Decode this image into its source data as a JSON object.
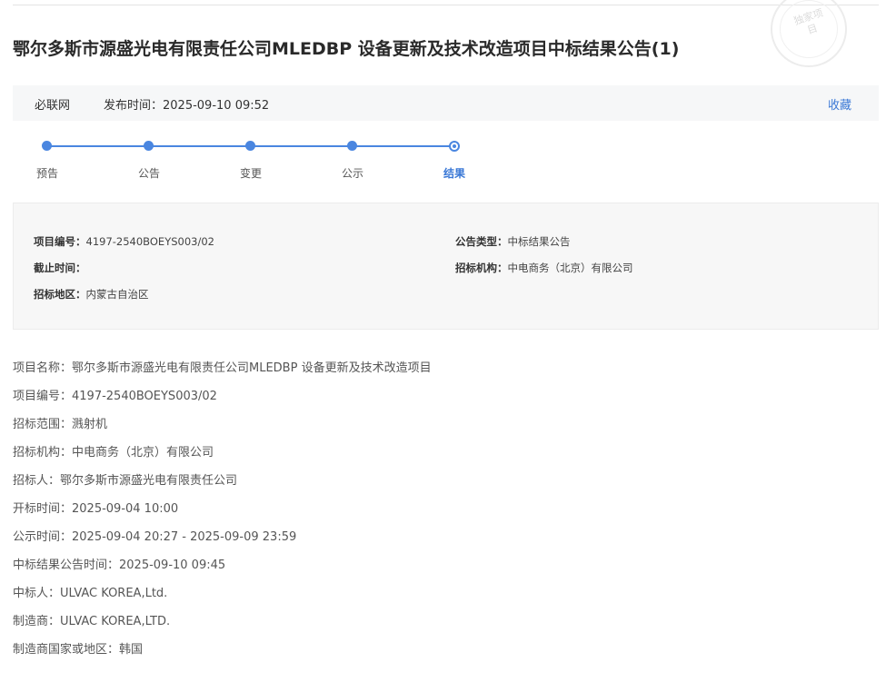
{
  "header": {
    "title": "鄂尔多斯市源盛光电有限责任公司MLEDBP 设备更新及技术改造项目中标结果公告(1)",
    "seal_text": "独家项目"
  },
  "meta": {
    "source": "必联网",
    "publish_label": "发布时间：",
    "publish_time": "2025-09-10 09:52",
    "favorite_label": "收藏"
  },
  "steps": {
    "items": [
      {
        "label": "预告"
      },
      {
        "label": "公告"
      },
      {
        "label": "变更"
      },
      {
        "label": "公示"
      },
      {
        "label": "结果"
      }
    ],
    "current_index": 4,
    "accent_color": "#4a86e0"
  },
  "info": {
    "project_no": {
      "label": "项目编号：",
      "value": "4197-2540BOEYS003/02"
    },
    "notice_type": {
      "label": "公告类型：",
      "value": "中标结果公告"
    },
    "deadline": {
      "label": "截止时间：",
      "value": ""
    },
    "agency": {
      "label": "招标机构：",
      "value": "中电商务（北京）有限公司"
    },
    "region": {
      "label": "招标地区：",
      "value": "内蒙古自治区"
    }
  },
  "details": [
    "项目名称：鄂尔多斯市源盛光电有限责任公司MLEDBP 设备更新及技术改造项目",
    "项目编号：4197-2540BOEYS003/02",
    "招标范围：溅射机",
    "招标机构：中电商务（北京）有限公司",
    "招标人：鄂尔多斯市源盛光电有限责任公司",
    "开标时间：2025-09-04 10:00",
    "公示时间：2025-09-04 20:27 - 2025-09-09 23:59",
    "中标结果公告时间：2025-09-10 09:45",
    "中标人：ULVAC KOREA,Ltd.",
    "制造商：ULVAC KOREA,LTD.",
    "制造商国家或地区：韩国"
  ]
}
